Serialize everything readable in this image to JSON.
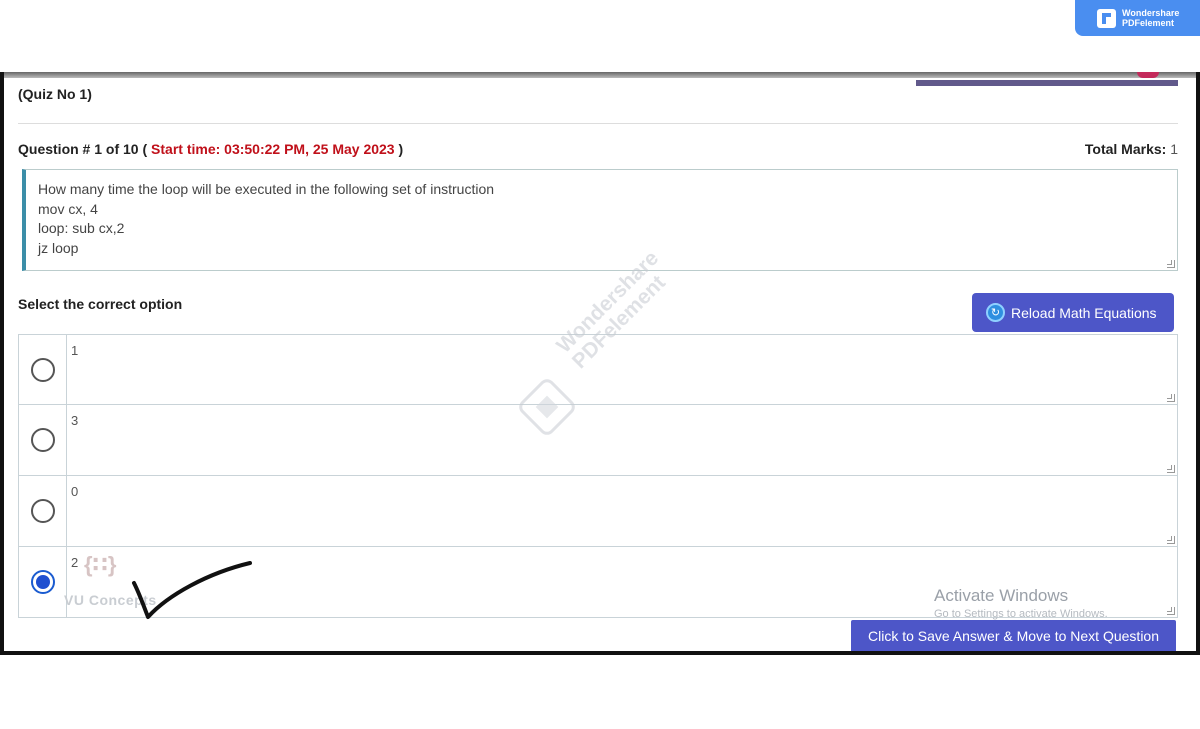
{
  "badge": {
    "line1": "Wondershare",
    "line2": "PDFelement"
  },
  "quiz": {
    "number_label": "(Quiz No 1)"
  },
  "question": {
    "header_prefix": "Question # 1 of 10 (",
    "start_time": "Start time: 03:50:22 PM, 25 May 2023",
    "header_suffix": ")",
    "total_marks_label": "Total Marks:",
    "total_marks_value": "1",
    "lines": [
      "How many time the loop will be executed in the following set of instruction",
      "mov cx, 4",
      "loop: sub cx,2",
      "jz loop"
    ]
  },
  "options_section": {
    "label": "Select the correct option",
    "reload_button": "Reload Math Equations",
    "options": [
      {
        "text": "1",
        "selected": false
      },
      {
        "text": "3",
        "selected": false
      },
      {
        "text": "0",
        "selected": false
      },
      {
        "text": "2",
        "selected": true
      }
    ]
  },
  "overlay": {
    "vu_brand": "VU Concepts",
    "watermark_line1": "Wondershare",
    "watermark_line2": "PDFelement",
    "activate_title": "Activate Windows",
    "activate_sub": "Go to Settings to activate Windows."
  },
  "footer": {
    "save_button": "Click to Save Answer & Move to Next Question"
  },
  "colors": {
    "accent": "#4d56c8",
    "start_time": "#c0101a",
    "badge": "#4a8ef0"
  }
}
